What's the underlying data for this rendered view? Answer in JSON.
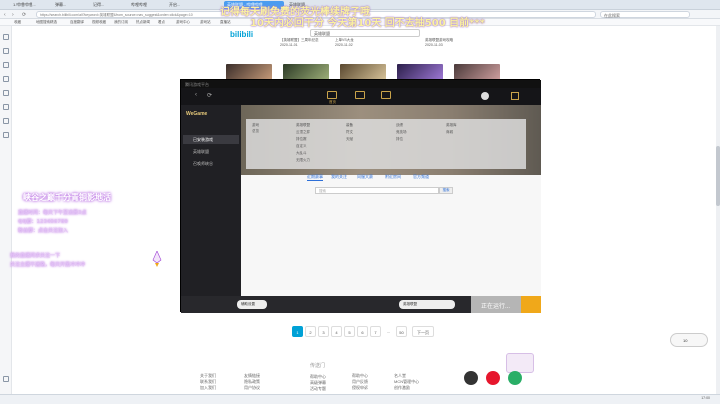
{
  "browser": {
    "tabs": [
      "1.哔哩哔哩...",
      "弹幕...",
      "记得...",
      "哔哩哔哩",
      "开启...",
      "...",
      "英雄联盟...",
      "…"
    ],
    "active_tab": "英雄联盟 - 哔哩哔哩",
    "url": "https://search.bilibili.com/all?keyword=英雄联盟&from_source=nav_suggest&order=click&page=10",
    "search_placeholder": "在此搜索"
  },
  "bookmarks": [
    "收藏",
    "地图搜索精选",
    "百度翻译",
    "视频收藏",
    "我的订阅",
    "热点新闻",
    "看点",
    "游戏中心",
    "游戏站",
    "直播站"
  ],
  "overlay": {
    "line1": "记得每天刷免费的荧光棒续牌子哦",
    "line2": "10天内必回干分 今天第10天 回不去抽500 目前***"
  },
  "bilibili": {
    "logo": "bilibili",
    "search_value": "英雄联盟"
  },
  "videos": [
    {
      "title": "【英雄联盟】三周年纪念",
      "meta": "2020-11-01"
    },
    {
      "title": "上单VS大龙",
      "meta": "2020-11-02"
    },
    {
      "title": "【剑圣】开挂直播",
      "meta": "2020-11-02"
    },
    {
      "title": "英雄联盟游戏攻略",
      "meta": "2020-11-03"
    }
  ],
  "launcher": {
    "title": "腾讯游戏平台",
    "nav": [
      "首页",
      "直播",
      "下载"
    ],
    "side_header": "WeGame",
    "side_items": [
      "已安装游戏",
      "英雄联盟",
      "召唤师峡谷",
      "我的游戏"
    ],
    "menu": {
      "col1": [
        "游戏",
        "总览"
      ],
      "col2": [
        "英雄联盟",
        "云顶之弈",
        "排位赛",
        "自定义",
        "大乱斗",
        "无限火力",
        "训练模式",
        "新手教程"
      ],
      "col3": [
        "装备",
        "符文",
        "天赋",
        "皮肤",
        "头像"
      ],
      "col4": [
        "战绩",
        "竞技场",
        "排位"
      ],
      "col5": [
        "英雄库",
        "商城",
        "活动"
      ]
    },
    "filters": [
      "近期赛事",
      "我的关注",
      "同服大赛",
      "附近房间",
      "官方频道"
    ],
    "search_placeholder": "搜索",
    "search_btn": "搜索",
    "bottom_left": "辅助设置",
    "game_select": "英雄联盟",
    "running": "正在运行..."
  },
  "pixel_text": {
    "title": "峡谷之巅千分青铜影地活",
    "lines": [
      "直播时间：每天下午至凌晨3点",
      "QQ群：123456789",
      "粉丝群：点击关注加入",
      "我的直播间求关注一下",
      "关注主播不迷路，每天开黑冲冲冲"
    ]
  },
  "pagination": [
    "1",
    "2",
    "3",
    "4",
    "5",
    "6",
    "7",
    "...",
    "50",
    "下一页"
  ],
  "footer": {
    "col1": {
      "items": [
        "关于我们",
        "联系我们",
        "加入我们"
      ]
    },
    "col2": {
      "items": [
        "友情链接",
        "隐私政策",
        "用户协议"
      ]
    },
    "col3": {
      "title": "传送门",
      "items": [
        "帮助中心",
        "高级弹幕",
        "活动专题"
      ]
    },
    "col4": {
      "items": [
        "帮助中心",
        "用户反馈",
        "侵权申诉"
      ]
    },
    "col5": {
      "items": [
        "名人堂",
        "MCN管理中心",
        "创作激励"
      ]
    }
  },
  "counter": "10",
  "taskbar": {
    "time": "17:00",
    "date": "2020/11/10"
  }
}
